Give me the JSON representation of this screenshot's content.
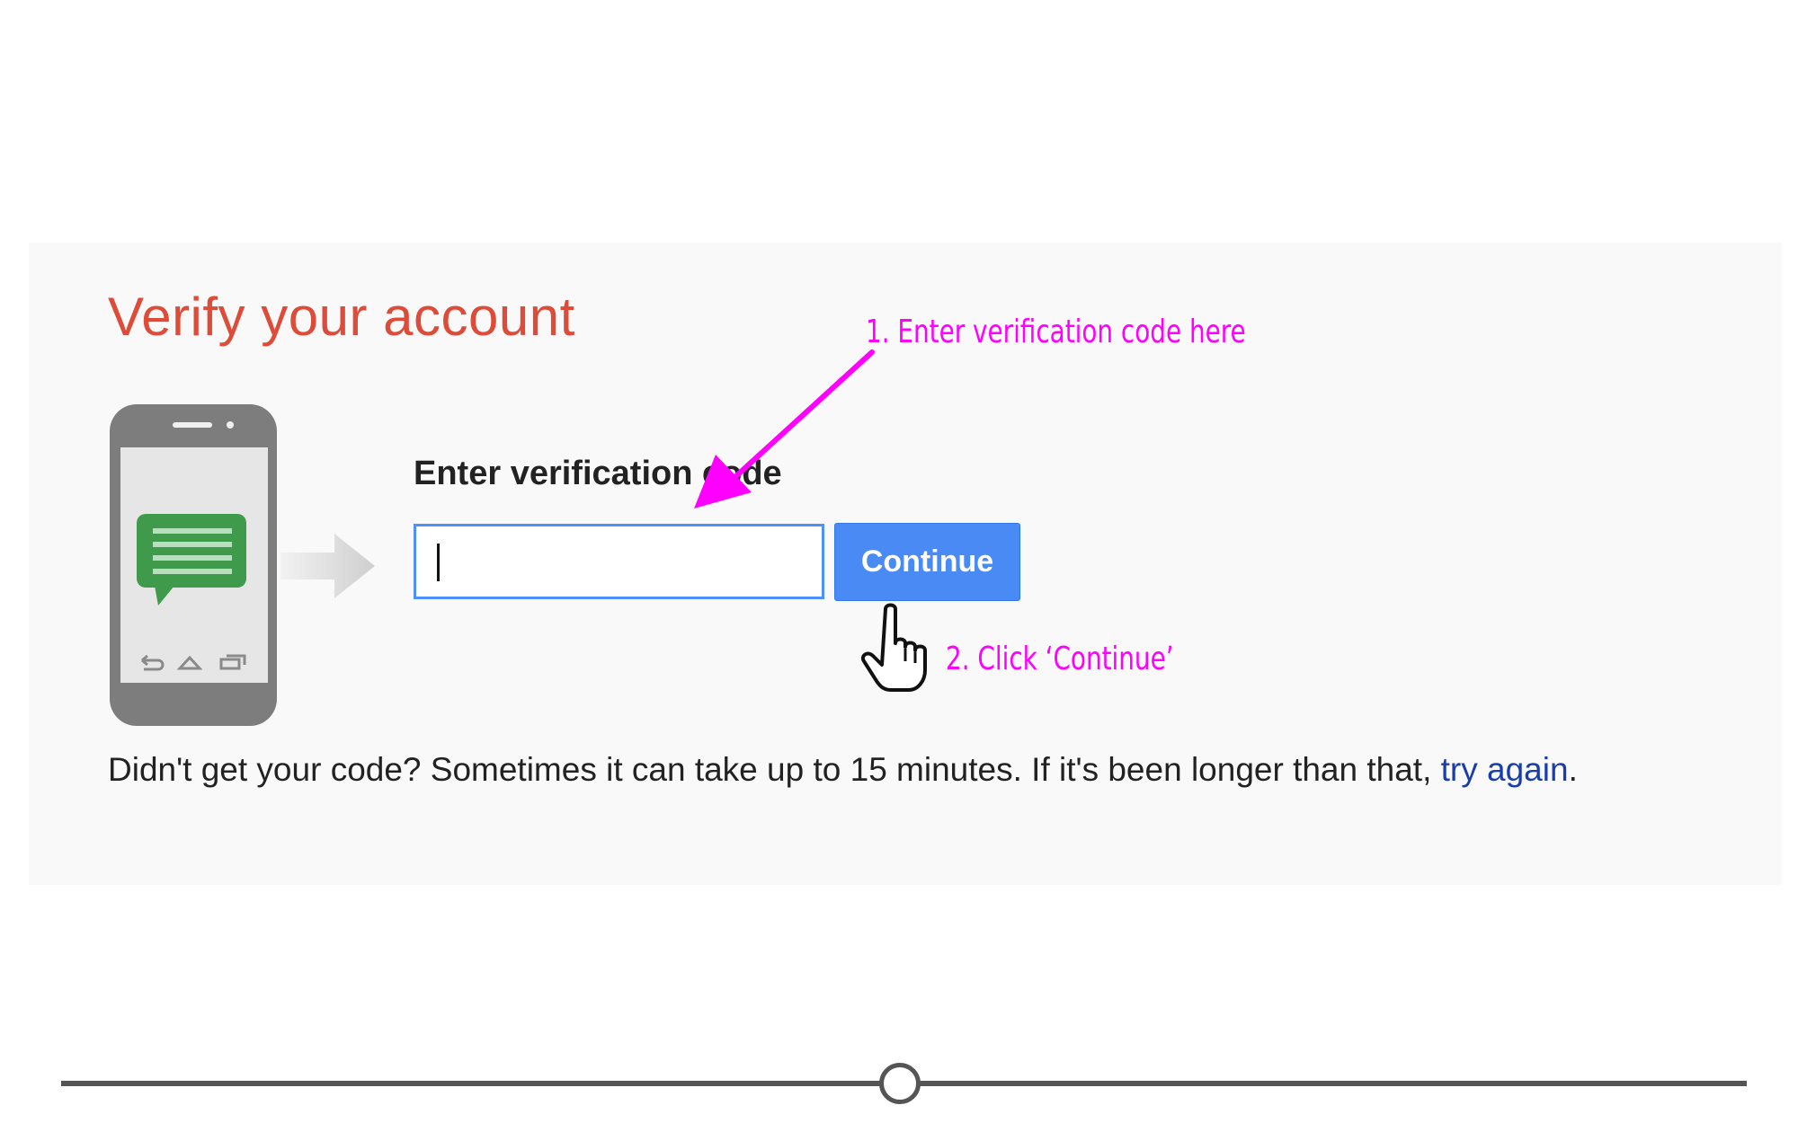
{
  "page": {
    "title": "Verify your account"
  },
  "verification": {
    "label": "Enter verification code",
    "code_value": "",
    "continue_label": "Continue"
  },
  "help": {
    "text": "Didn't get your code? Sometimes it can take up to 15 minutes. If it's been longer than that, ",
    "link_text": "try again",
    "suffix": "."
  },
  "annotations": {
    "step1": "1. Enter verification code here",
    "step2": "2. Click ‘Continue’"
  },
  "icons": {
    "phone": "phone-icon",
    "message": "message-bubble-icon",
    "arrow": "right-arrow-icon",
    "cursor": "hand-pointer-icon"
  },
  "colors": {
    "title": "#dd4b39",
    "button": "#4a8af4",
    "input_border": "#4d90fe",
    "annotation": "#ff00ff",
    "link": "#1a3ea8",
    "message_bubble": "#3f9a4b"
  }
}
